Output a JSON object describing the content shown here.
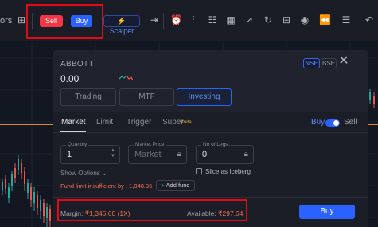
{
  "toolbar": {
    "left_label": "ors",
    "sell_label": "Sell",
    "buy_label": "Buy",
    "scalper_label": "Scalper"
  },
  "order": {
    "symbol": "ABBOTT",
    "price": "0.00",
    "exchanges": [
      "NSE",
      "BSE"
    ],
    "product_types": [
      "Trading",
      "MTF",
      "Investing"
    ],
    "active_product": "Investing",
    "order_tabs": [
      "Market",
      "Limit",
      "Trigger",
      "Super"
    ],
    "super_badge": "beta",
    "side_buy": "Buy",
    "side_sell": "Sell",
    "quantity_label": "Quantity",
    "quantity_value": "1",
    "market_price_label": "Market Price",
    "market_price_placeholder": "Market",
    "legs_label": "No of Legs",
    "legs_value": "0",
    "show_options": "Show Options",
    "slice_label": "Slice as Iceberg",
    "warning": "Fund limit insufficient by : 1,048.96",
    "add_fund": "Add fund",
    "margin_label": "Margin:",
    "margin_value": "₹1,346.60 (1X)",
    "available_label": "Available:",
    "available_value": "₹297.64",
    "buy_button": "Buy"
  },
  "colors": {
    "sell": "#f23645",
    "buy": "#2962ff",
    "warning": "#f26d4f",
    "highlight_box": "#e50914"
  }
}
